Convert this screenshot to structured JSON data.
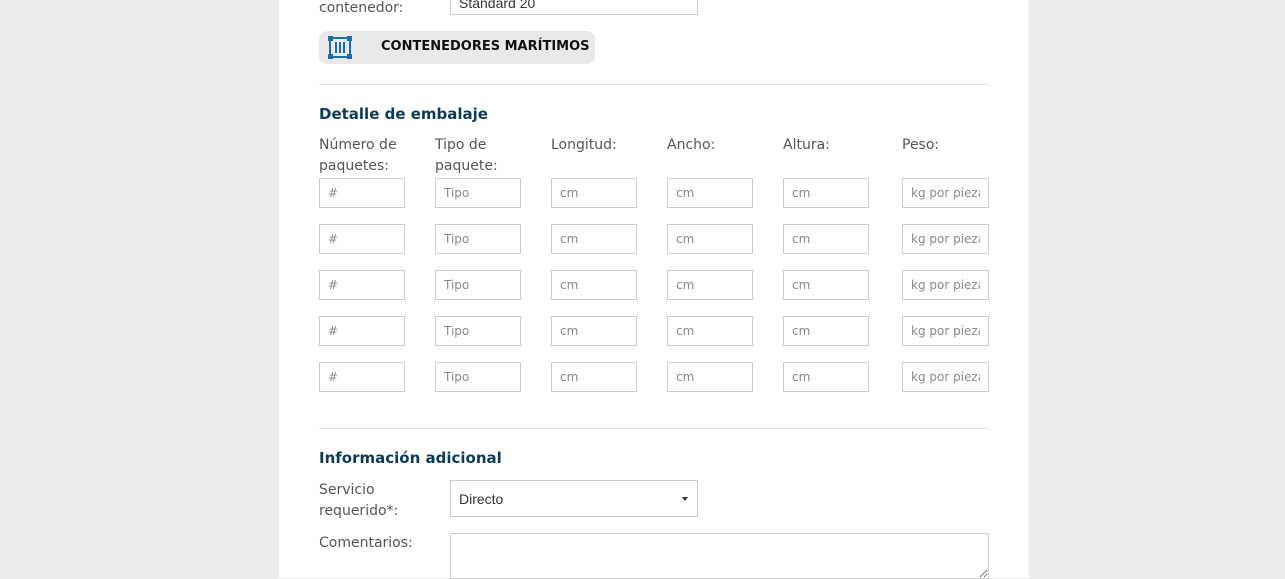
{
  "container_section": {
    "label_fragment": "contenedor:",
    "select_value": "Standard 20",
    "button_label": "CONTENEDORES MARÍTIMOS",
    "button_icon": "shipping-container-icon",
    "icon_color": "#1b6fa8"
  },
  "packaging": {
    "title": "Detalle de embalaje",
    "columns": [
      {
        "label_line1": "Número de",
        "label_line2": "paquetes:",
        "placeholder": "#"
      },
      {
        "label_line1": "Tipo de",
        "label_line2": "paquete:",
        "placeholder": "Tipo"
      },
      {
        "label_line1": "Longitud:",
        "label_line2": "",
        "placeholder": "cm"
      },
      {
        "label_line1": "Ancho:",
        "label_line2": "",
        "placeholder": "cm"
      },
      {
        "label_line1": "Altura:",
        "label_line2": "",
        "placeholder": "cm"
      },
      {
        "label_line1": "Peso:",
        "label_line2": "",
        "placeholder": "kg por pieza"
      }
    ],
    "row_count": 5
  },
  "additional": {
    "title": "Información adicional",
    "service_label_line1": "Servicio",
    "service_label_line2": "requerido*:",
    "service_value": "Directo",
    "comments_label": "Comentarios:"
  },
  "colors": {
    "heading": "#0d3b55",
    "page_background": "#ececec",
    "panel_background": "#ffffff"
  }
}
